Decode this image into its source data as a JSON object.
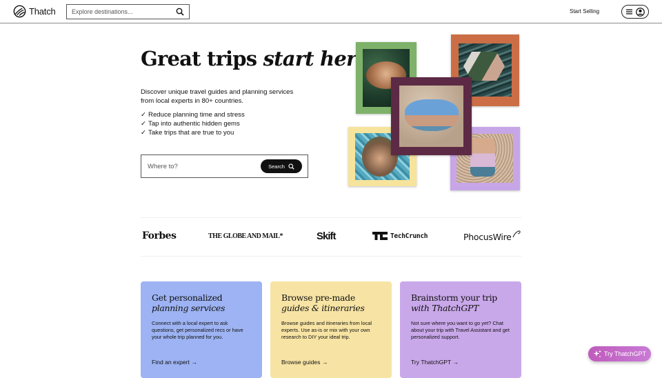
{
  "header": {
    "logo_text": "Thatch",
    "search_placeholder": "Explore destinations...",
    "start_selling": "Start Selling"
  },
  "hero": {
    "title_regular": "Great trips",
    "title_italic": "start here",
    "description": "Discover unique travel guides and planning services from local experts in 80+ countries.",
    "checkmark_glyph": "✓",
    "benefits": [
      "Reduce planning time and stress",
      "Tap into authentic hidden gems",
      "Take trips that are true to you"
    ],
    "search_placeholder": "Where to?",
    "search_button": "Search"
  },
  "collage": {
    "frames": [
      {
        "name": "green-frame",
        "color": "#7eb26a"
      },
      {
        "name": "orange-frame",
        "color": "#cc6e45"
      },
      {
        "name": "maroon-frame",
        "color": "#5c2a44"
      },
      {
        "name": "yellow-frame",
        "color": "#f6e39c"
      },
      {
        "name": "lavender-frame",
        "color": "#c7a6e8"
      }
    ]
  },
  "press": {
    "logos": [
      "Forbes",
      "THE GLOBE AND MAIL*",
      "Skift",
      "TechCrunch",
      "PhocusWire"
    ]
  },
  "cards": [
    {
      "title_line1": "Get personalized",
      "title_line2": "planning services",
      "body": "Connect with a local expert to ask questions, get personalized recs or have your whole trip planned for you.",
      "link": "Find an expert →",
      "color": "#9db3f3"
    },
    {
      "title_line1": "Browse pre-made",
      "title_line2": "guides & itineraries",
      "body": "Browse guides and itineraries from local experts. Use as-is or mix with your own research to DIY your ideal trip.",
      "link": "Browse guides →",
      "color": "#f7e4a4"
    },
    {
      "title_line1": "Brainstorm your trip",
      "title_line2": "with ThatchGPT",
      "body": "Not sure where you want to go yet? Chat about your trip with Travel Assistant and get personalized support.",
      "link": "Try ThatchGPT →",
      "color": "#c9a8ea"
    }
  ],
  "floating_button": {
    "label": "Try ThatchGPT"
  }
}
